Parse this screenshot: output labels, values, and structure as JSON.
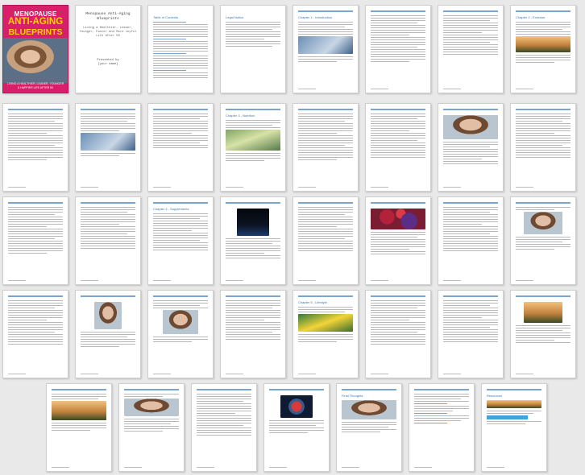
{
  "cover": {
    "title_top": "MENOPAUSE",
    "title_main": "ANTI-AGING",
    "title_sub": "BLUEPRINTS",
    "strapline": "LIVING A HEALTHIER, LEANER, YOUNGER & HAPPIER LIFE AFTER 50"
  },
  "title_page": {
    "title": "Menopause Anti-Aging Blueprints",
    "subtitle": "Living a Healthier, Leaner, Younger, Faster and More Joyful Life After 50",
    "author_line1": "Presented by",
    "author_line2": "[your name]"
  },
  "headings": {
    "toc": "Table of Contents",
    "legal": "Legal Notice",
    "ch1": "Chapter 1 - Introduction",
    "ch2": "Chapter 2 - Exercise",
    "ch3": "Chapter 3 - Nutrition",
    "ch4": "Chapter 4 - Supplements",
    "ch5": "Chapter 5 - Lifestyle",
    "final": "Final Thoughts",
    "resources": "Resources"
  }
}
